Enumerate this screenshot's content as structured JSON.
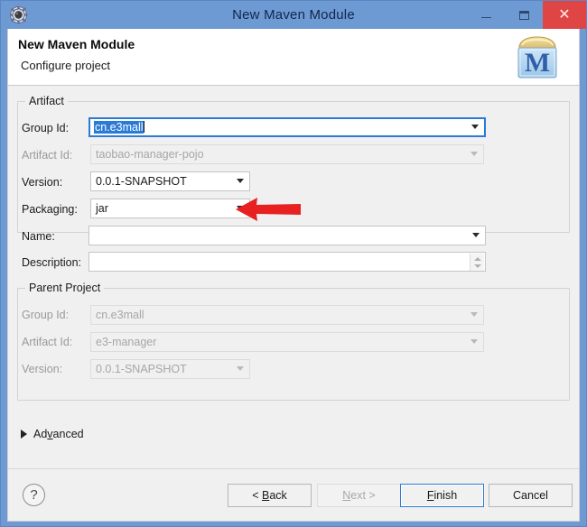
{
  "window": {
    "title": "New Maven Module",
    "icon": "gear-icon",
    "controls": {
      "minimize": "minimize-icon",
      "maximize": "maximize-icon",
      "close": "close-icon",
      "close_glyph": "✕"
    },
    "titlebar_color": "#6e9ad4",
    "close_color": "#e04545"
  },
  "banner": {
    "title": "New Maven Module",
    "subtitle": "Configure project",
    "icon": "maven-module-icon",
    "icon_letter": "M"
  },
  "artifact": {
    "legend": "Artifact",
    "fields": [
      {
        "name": "group-id",
        "label": "Group Id:",
        "value": "cn.e3mall",
        "state": "focused",
        "selected": true,
        "control": "combo"
      },
      {
        "name": "artifact-id",
        "label": "Artifact Id:",
        "value": "taobao-manager-pojo",
        "state": "disabled",
        "control": "combo"
      },
      {
        "name": "version",
        "label": "Version:",
        "value": "0.0.1-SNAPSHOT",
        "state": "enabled",
        "control": "combo"
      },
      {
        "name": "packaging",
        "label": "Packaging:",
        "value": "jar",
        "state": "enabled",
        "control": "combo"
      },
      {
        "name": "name",
        "label": "Name:",
        "value": "",
        "state": "enabled",
        "control": "combo"
      },
      {
        "name": "description",
        "label": "Description:",
        "value": "",
        "state": "enabled",
        "control": "textarea-spinner"
      }
    ]
  },
  "parent_project": {
    "legend": "Parent Project",
    "fields": [
      {
        "name": "parent-group-id",
        "label": "Group Id:",
        "value": "cn.e3mall",
        "state": "disabled",
        "control": "combo"
      },
      {
        "name": "parent-artifact-id",
        "label": "Artifact Id:",
        "value": "e3-manager",
        "state": "disabled",
        "control": "combo"
      },
      {
        "name": "parent-version",
        "label": "Version:",
        "value": "0.0.1-SNAPSHOT",
        "state": "disabled",
        "control": "combo"
      }
    ]
  },
  "advanced": {
    "label_before": "Ad",
    "label_mnemonic": "v",
    "label_after": "anced",
    "expanded": false
  },
  "buttons": {
    "help": "?",
    "back_before": "< ",
    "back_mnemonic": "B",
    "back_after": "ack",
    "next_before": "",
    "next_mnemonic": "N",
    "next_after": "ext >",
    "next_enabled": false,
    "finish_before": "",
    "finish_mnemonic": "F",
    "finish_after": "inish",
    "finish_default": true,
    "cancel": "Cancel"
  },
  "annotation": {
    "name": "red-arrow-pointing-to-packaging",
    "color": "#e82020",
    "direction": "left"
  }
}
